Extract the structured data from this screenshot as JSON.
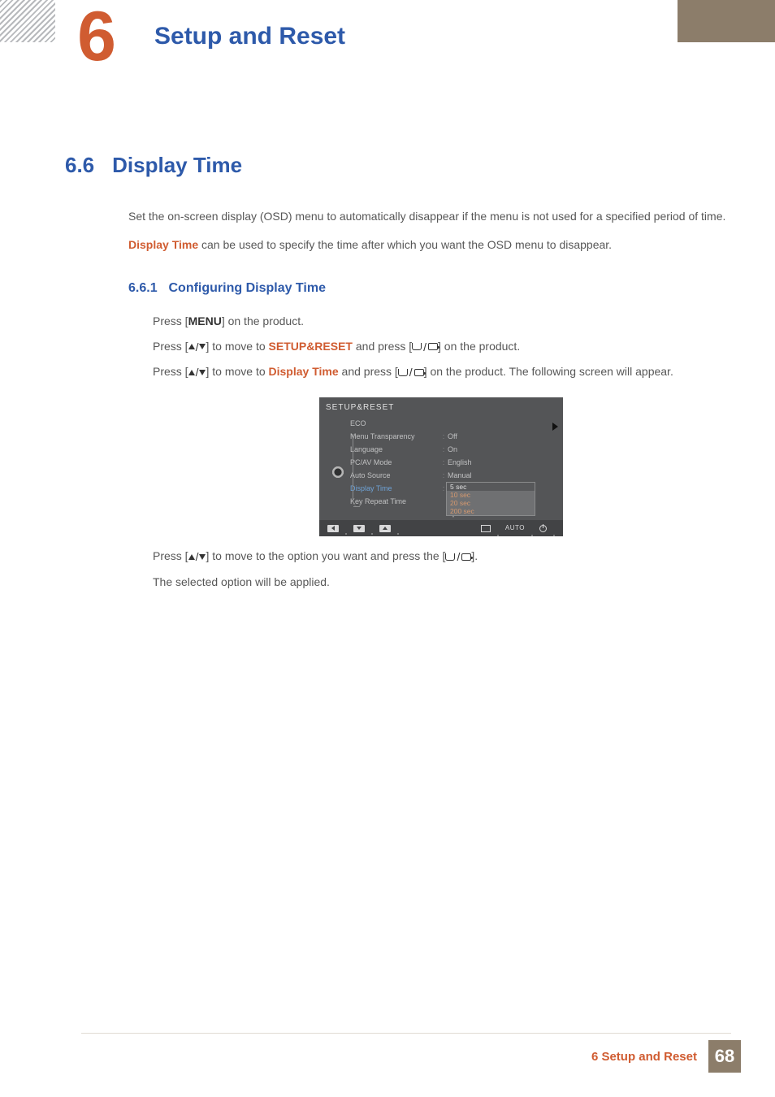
{
  "header": {
    "chapter_number": "6",
    "chapter_title": "Setup and Reset"
  },
  "section": {
    "number": "6.6",
    "title": "Display Time",
    "intro_p1": "Set the on-screen display (OSD) menu to automatically disappear if the menu is not used for a specified period of time.",
    "intro_keyword": "Display Time",
    "intro_p2_rest": " can be used to specify the time after which you want the OSD menu to disappear."
  },
  "subsection": {
    "number": "6.6.1",
    "title": "Configuring Display Time",
    "steps": {
      "s1_a": "Press [",
      "s1_menu": "MENU",
      "s1_b": "] on the product.",
      "s2_a": "Press [",
      "s2_b": "] to move to ",
      "s2_kw": "SETUP&RESET",
      "s2_c": " and press [",
      "s2_d": "] on the product.",
      "s3_a": "Press [",
      "s3_b": "] to move to ",
      "s3_kw": "Display Time",
      "s3_c": " and press [",
      "s3_d": "] on the product. The following screen will appear.",
      "s4_a": "Press [",
      "s4_b": "] to move to the option you want and press the [",
      "s4_c": "].",
      "s5": "The selected option will be applied."
    }
  },
  "osd": {
    "title": "SETUP&RESET",
    "rows": [
      {
        "label": "ECO",
        "val": ""
      },
      {
        "label": "Menu Transparency",
        "val": "Off"
      },
      {
        "label": "Language",
        "val": "On"
      },
      {
        "label": "PC/AV Mode",
        "val": "English"
      },
      {
        "label": "Auto Source",
        "val": "Manual"
      },
      {
        "label": "Display Time",
        "val": ""
      },
      {
        "label": "Key Repeat Time",
        "val": ""
      }
    ],
    "popup": [
      "5 sec",
      "10 sec",
      "20 sec",
      "200 sec"
    ],
    "footer_auto": "AUTO"
  },
  "footer": {
    "text": "6 Setup and Reset",
    "page": "68"
  }
}
